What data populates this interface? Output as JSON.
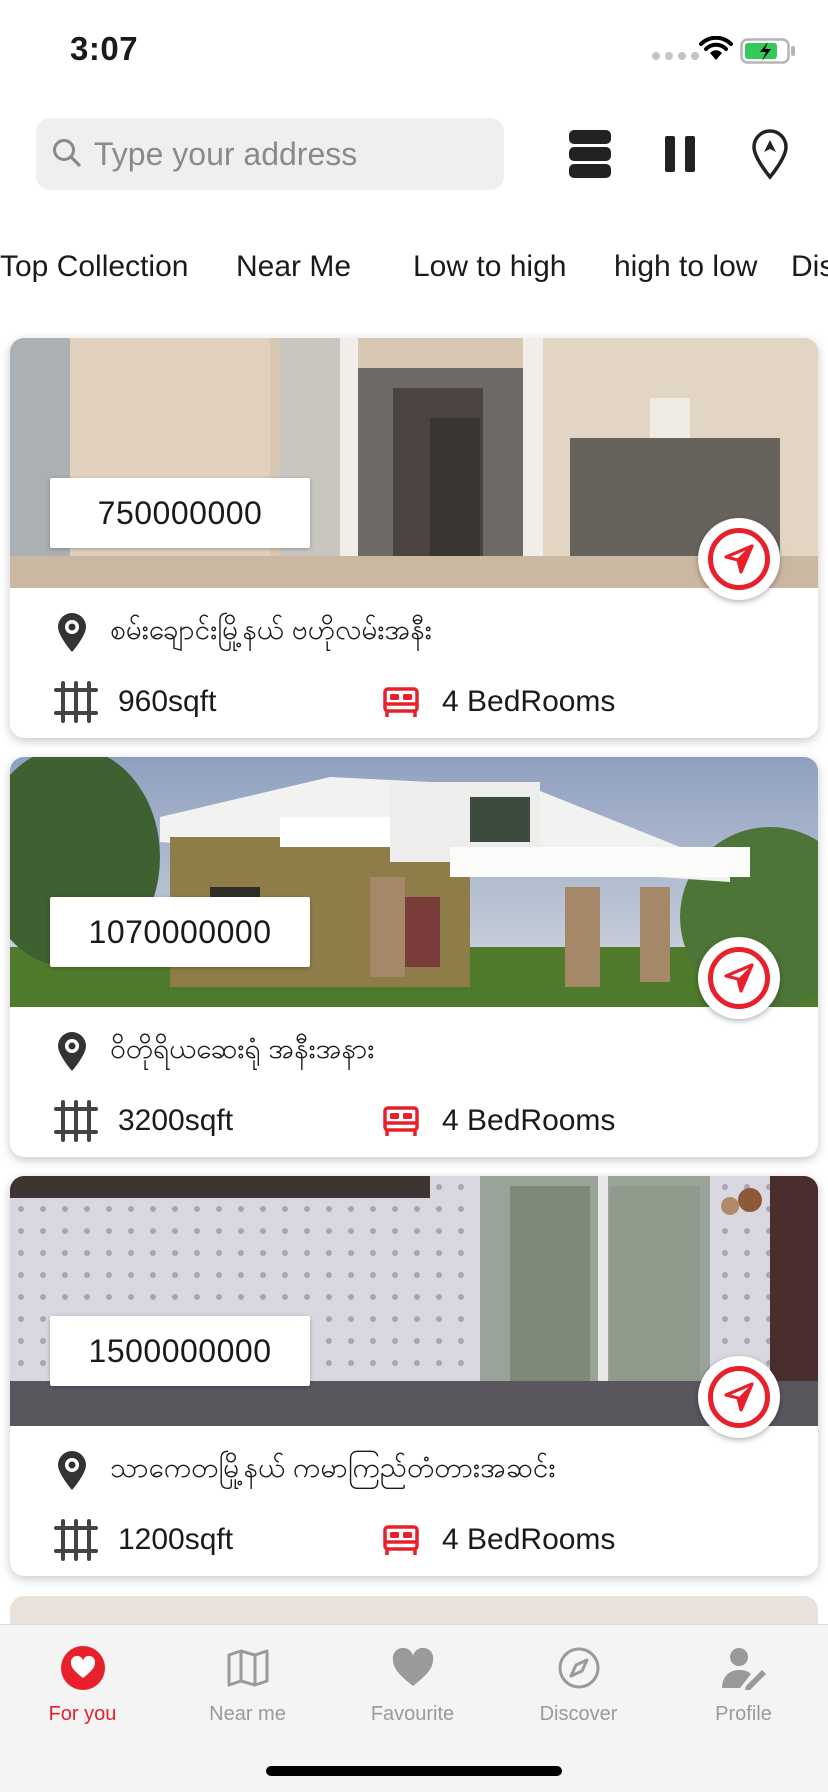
{
  "status_bar": {
    "time": "3:07"
  },
  "search": {
    "placeholder": "Type your address",
    "value": ""
  },
  "toolbar": {
    "icons": [
      "list-view-icon",
      "pause-icon",
      "location-pin-icon"
    ]
  },
  "filters": [
    "Top Collection",
    "Near Me",
    "Low to high",
    "high to low",
    "Dis"
  ],
  "listings": [
    {
      "price": "750000000",
      "address": "စမ်းချောင်းမြို့နယ် ဗဟိုလမ်းအနီး",
      "size": "960sqft",
      "bedrooms": "4 BedRooms"
    },
    {
      "price": "1070000000",
      "address": "ဝိတိုရိယဆေးရုံ အနီးအနား",
      "size": "3200sqft",
      "bedrooms": "4 BedRooms"
    },
    {
      "price": "1500000000",
      "address": "သာကေတမြို့နယ် ကမာကြည်တံတားအဆင်း",
      "size": "1200sqft",
      "bedrooms": "4 BedRooms"
    }
  ],
  "tab_bar": {
    "items": [
      {
        "label": "For you",
        "icon": "heart-circle-icon",
        "active": true
      },
      {
        "label": "Near me",
        "icon": "map-icon",
        "active": false
      },
      {
        "label": "Favourite",
        "icon": "heart-icon",
        "active": false
      },
      {
        "label": "Discover",
        "icon": "compass-icon",
        "active": false
      },
      {
        "label": "Profile",
        "icon": "user-edit-icon",
        "active": false
      }
    ]
  },
  "colors": {
    "accent": "#e8202c",
    "inactive": "#9a9a9a",
    "search_bg": "#efefef"
  }
}
